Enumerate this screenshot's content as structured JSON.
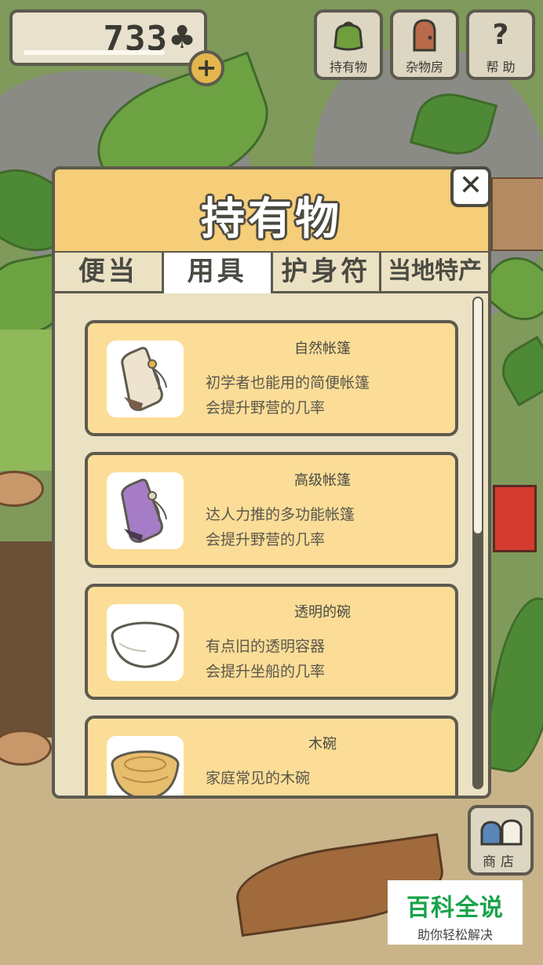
{
  "hud": {
    "clover_count": "733",
    "clover_icon": "clover-icon",
    "plus_label": "+",
    "buttons": [
      {
        "label": "持有物",
        "icon": "bag-icon"
      },
      {
        "label": "杂物房",
        "icon": "door-icon"
      },
      {
        "label": "帮 助",
        "icon": "question-icon"
      }
    ]
  },
  "panel": {
    "title": "持有物",
    "close_label": "✕",
    "tabs": [
      "便当",
      "用具",
      "护身符",
      "当地特产"
    ],
    "active_tab": "用具",
    "items": [
      {
        "name": "自然帐篷",
        "desc": "初学者也能用的简便帐篷\n会提升野营的几率",
        "icon": "tent-bag-icon",
        "color": "#ede3cf"
      },
      {
        "name": "高级帐篷",
        "desc": "达人力推的多功能帐篷\n会提升野营的几率",
        "icon": "tent-bag-icon",
        "color": "#a67cc6"
      },
      {
        "name": "透明的碗",
        "desc": "有点旧的透明容器\n会提升坐船的几率",
        "icon": "bowl-icon",
        "color": "#ffffff"
      },
      {
        "name": "木碗",
        "desc": "家庭常见的木碗\n会提升坐船的几率",
        "icon": "wood-bowl-icon",
        "color": "#e7bd6e"
      }
    ]
  },
  "shop": {
    "label": "商店",
    "icon": "shop-bags-icon"
  },
  "watermark": {
    "main": "百科全说",
    "sub": "助你轻松解决"
  },
  "colors": {
    "panel_bg": "#ebe1c3",
    "header_bg": "#f6cd78",
    "card_bg": "#fbdd97",
    "border": "#5d5a4e"
  }
}
